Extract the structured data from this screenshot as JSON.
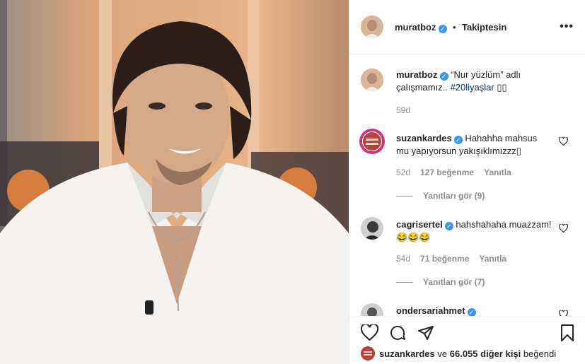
{
  "header": {
    "username": "muratboz",
    "separator": "•",
    "follow_status": "Takiptesin",
    "more_icon": "more-horizontal-icon"
  },
  "caption": {
    "username": "muratboz",
    "text": "“Nur yüzlüm” adlı çalışmamız.. ",
    "hashtag": "#20liyaşlar",
    "emoji": "▯▯",
    "time": "59d"
  },
  "comments": [
    {
      "username": "suzankardes",
      "text": "Hahahha mahsus mu yapıyorsun yakışıklımızzz▯",
      "time": "52d",
      "likes": "127 beğenme",
      "reply": "Yanıtla",
      "view_replies": "Yanıtları gör (9)"
    },
    {
      "username": "cagrisertel",
      "text": "hahshahaha muazzam! 😂😂😂",
      "time": "54d",
      "likes": "71 beğenme",
      "reply": "Yanıtla",
      "view_replies": "Yanıtları gör (7)"
    },
    {
      "username": "ondersariahmet",
      "text": ""
    }
  ],
  "footer": {
    "liked_by_user": "suzankardes",
    "liked_by_text": "ve",
    "others_count": "66.055 diğer kişi",
    "liked_suffix": "beğendi"
  },
  "colors": {
    "verified": "#3897f0",
    "text": "#262626",
    "muted": "#8e8e8e",
    "hashtag": "#00376b"
  }
}
